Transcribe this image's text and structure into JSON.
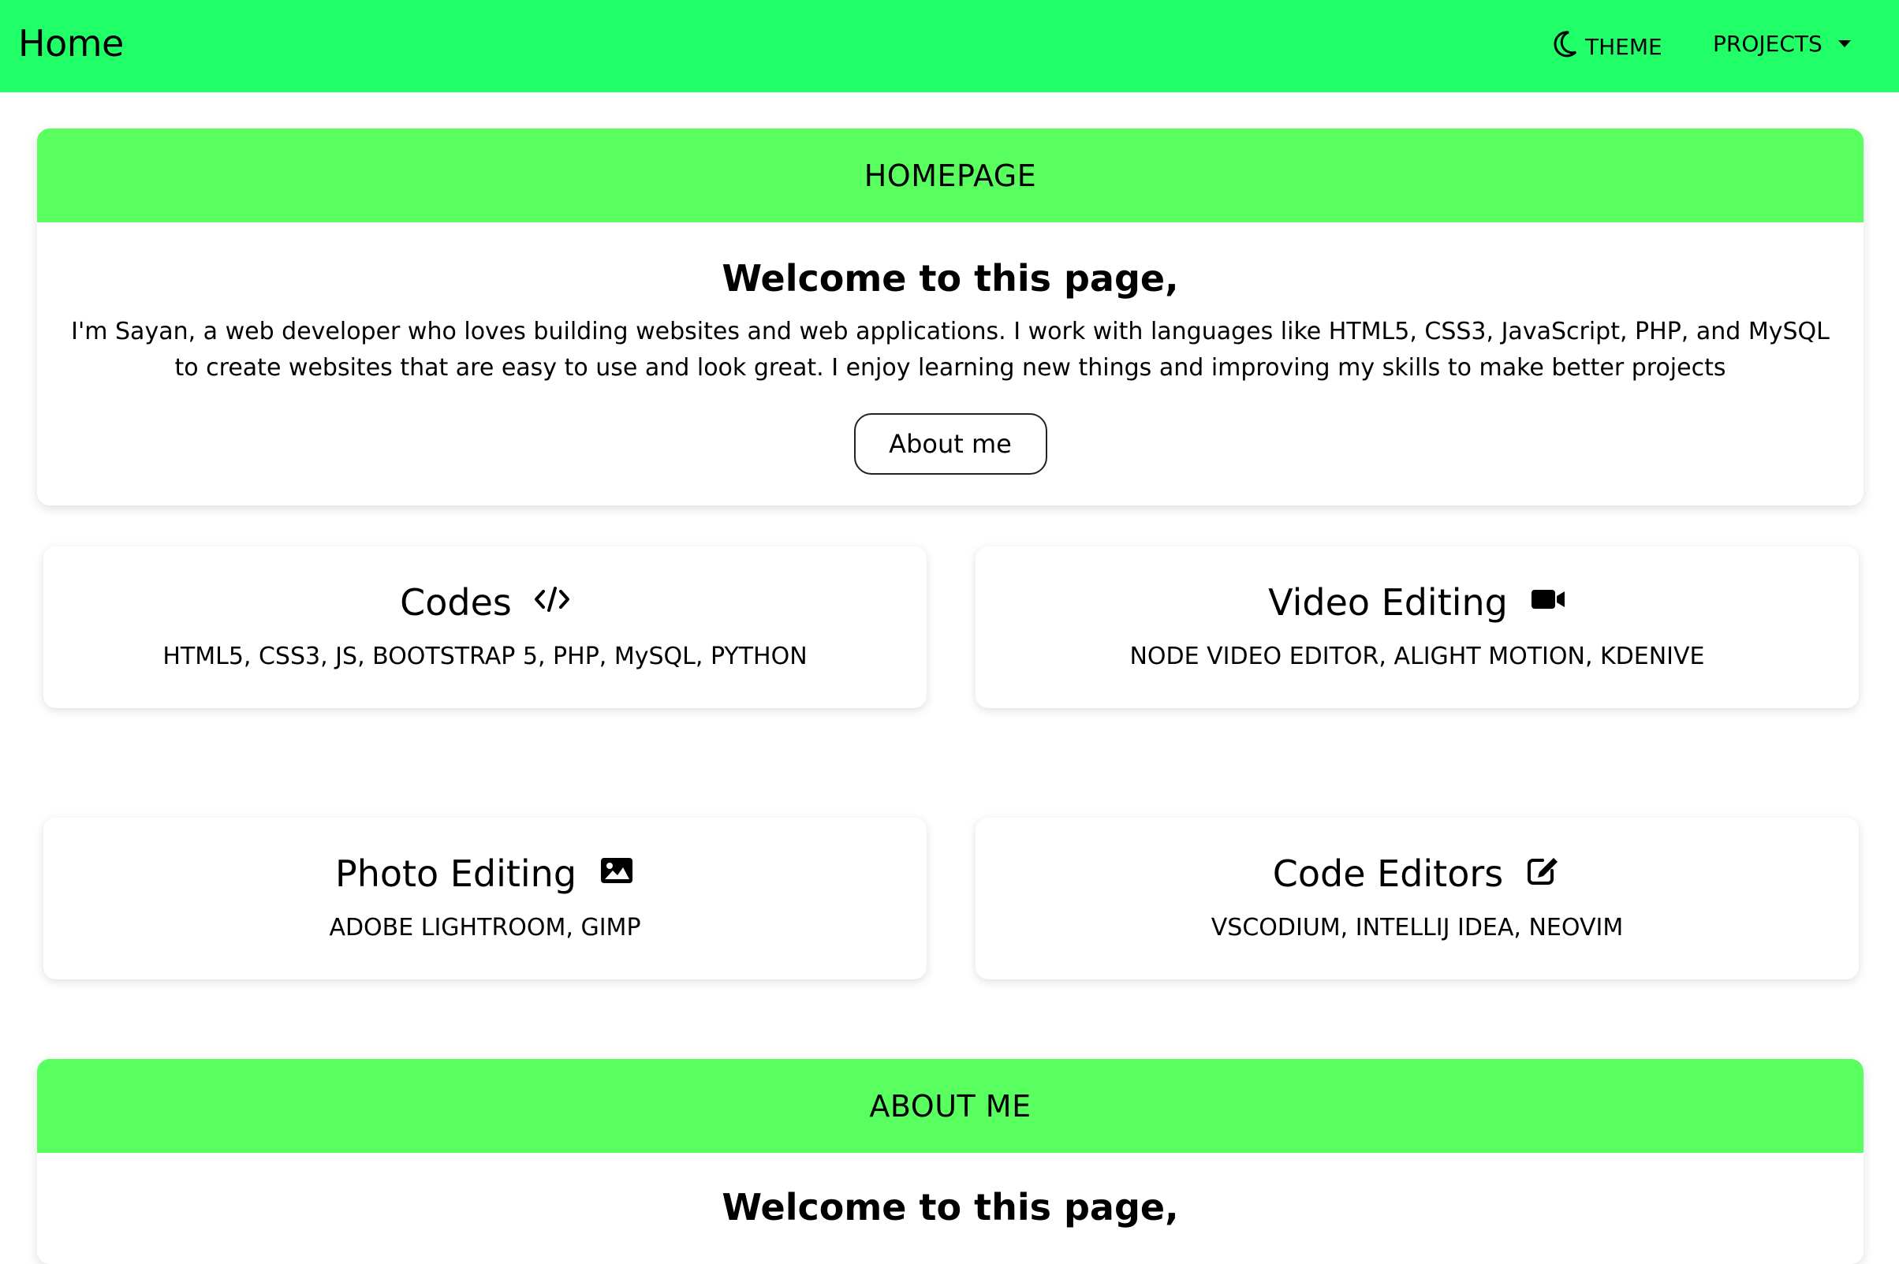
{
  "navbar": {
    "brand": "Home",
    "theme_label": "THEME",
    "projects_label": "PROJECTS",
    "bg_color": "#21ff68"
  },
  "hero": {
    "header": "HOMEPAGE",
    "title": "Welcome to this page,",
    "text": "I'm Sayan, a web developer who loves building websites and web applications. I work with languages like HTML5, CSS3, JavaScript, PHP, and MySQL to create websites that are easy to use and look great. I enjoy learning new things and improving my skills to make better projects",
    "button_label": "About me",
    "header_color": "#59ff5e"
  },
  "skills": [
    {
      "title": "Codes",
      "icon": "code-icon",
      "items": "HTML5, CSS3, JS, BOOTSTRAP 5, PHP, MySQL, PYTHON"
    },
    {
      "title": "Video Editing",
      "icon": "video-camera-icon",
      "items": "NODE VIDEO EDITOR, ALIGHT MOTION, KDENIVE"
    },
    {
      "title": "Photo Editing",
      "icon": "image-icon",
      "items": "ADOBE LIGHTROOM, GIMP"
    },
    {
      "title": "Code Editors",
      "icon": "edit-icon",
      "items": "VSCODIUM, INTELLIJ IDEA, NEOVIM"
    }
  ],
  "about": {
    "header": "ABOUT ME",
    "title": "Welcome to this page,"
  }
}
